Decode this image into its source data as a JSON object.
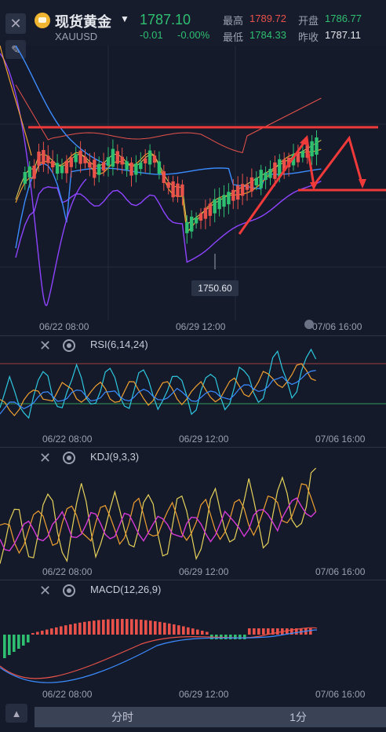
{
  "header": {
    "title": "现货黄金",
    "symbol": "XAUUSD",
    "price": "1787.10",
    "change": "-0.01",
    "change_pct": "-0.00%",
    "high_label": "最高",
    "high_value": "1789.72",
    "open_label": "开盘",
    "open_value": "1786.77",
    "low_label": "最低",
    "low_value": "1784.33",
    "prev_close_label": "昨收",
    "prev_close_value": "1787.11"
  },
  "main_chart": {
    "low_marker": "1750.60",
    "x_ticks": [
      "06/22 08:00",
      "06/29 12:00",
      "07/06 16:00"
    ]
  },
  "rsi": {
    "label": "RSI(6,14,24)",
    "x_ticks": [
      "06/22 08:00",
      "06/29 12:00",
      "07/06 16:00"
    ]
  },
  "kdj": {
    "label": "KDJ(9,3,3)",
    "x_ticks": [
      "06/22 08:00",
      "06/29 12:00",
      "07/06 16:00"
    ]
  },
  "macd": {
    "label": "MACD(12,26,9)",
    "x_ticks": [
      "06/22 08:00",
      "06/29 12:00",
      "07/06 16:00"
    ]
  },
  "footer": {
    "tab1": "分时",
    "tab2": "1分"
  },
  "colors": {
    "up": "#2fbf71",
    "down": "#e8524a",
    "background": "#141a2a",
    "annotation": "#f03a3a"
  }
}
